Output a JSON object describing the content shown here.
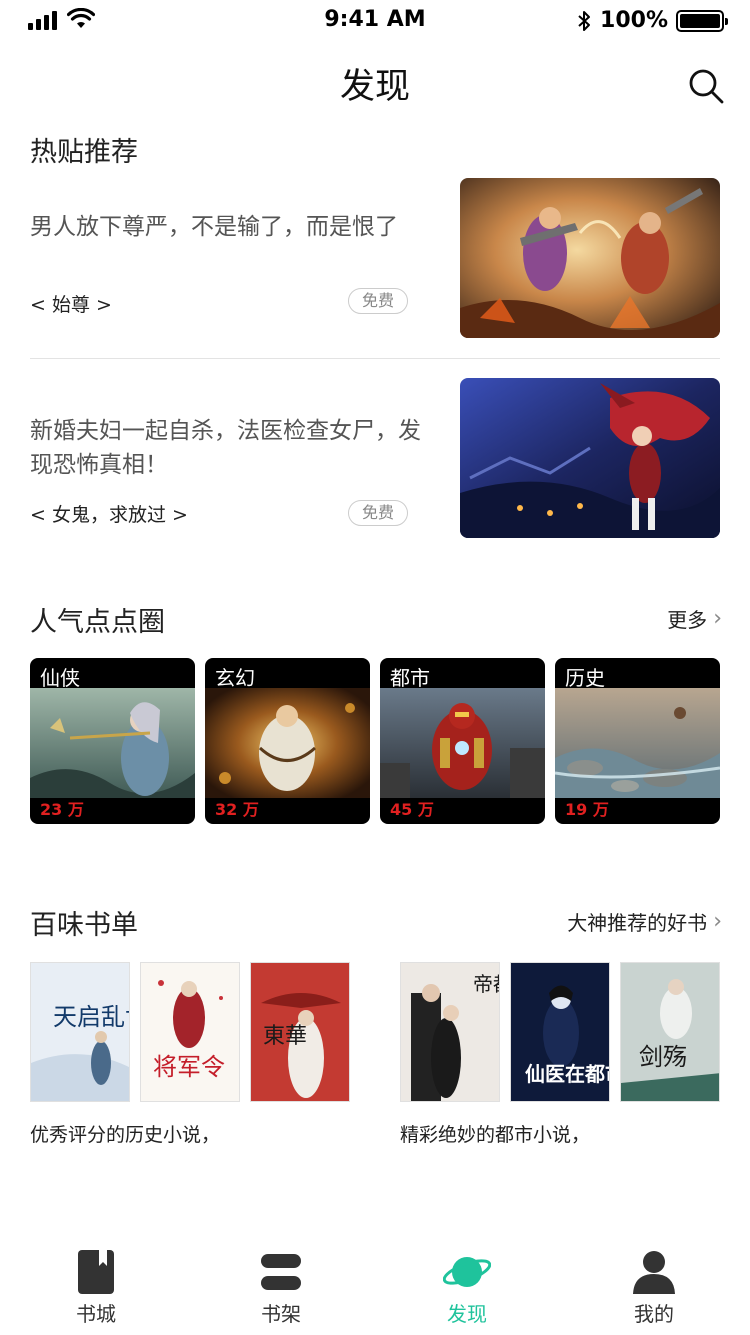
{
  "status_bar": {
    "time": "9:41 AM",
    "battery": "100%"
  },
  "header": {
    "title": "发现"
  },
  "hot_posts": {
    "title": "热贴推荐",
    "items": [
      {
        "title": "男人放下尊严，不是输了，而是恨了",
        "book": "< 始尊 >",
        "badge": "免费"
      },
      {
        "title": "新婚夫妇一起自杀，法医检查女尸，发现恐怖真相！",
        "book": "< 女鬼，求放过 >",
        "badge": "免费"
      }
    ]
  },
  "circles": {
    "title": "人气点点圈",
    "more": "更多",
    "items": [
      {
        "name": "仙侠",
        "count": "23 万"
      },
      {
        "name": "玄幻",
        "count": "32 万"
      },
      {
        "name": "都市",
        "count": "45 万"
      },
      {
        "name": "历史",
        "count": "19 万"
      }
    ]
  },
  "booklists": {
    "title": "百味书单",
    "more": "大神推荐的好书",
    "lists": [
      {
        "desc": "优秀评分的历史小说，",
        "covers": [
          "天启乱世",
          "将军令",
          "東華"
        ]
      },
      {
        "desc": "精彩绝妙的都市小说，",
        "covers": [
          "帝都夜生活",
          "仙医在都市",
          "剑殇"
        ]
      }
    ]
  },
  "tabbar": {
    "items": [
      {
        "label": "书城",
        "icon": "book-icon"
      },
      {
        "label": "书架",
        "icon": "shelf-icon"
      },
      {
        "label": "发现",
        "icon": "planet-icon"
      },
      {
        "label": "我的",
        "icon": "person-icon"
      }
    ],
    "active_color": "#1fc39c"
  },
  "colors": {
    "price_red": "#e02020",
    "accent": "#1fc39c"
  }
}
